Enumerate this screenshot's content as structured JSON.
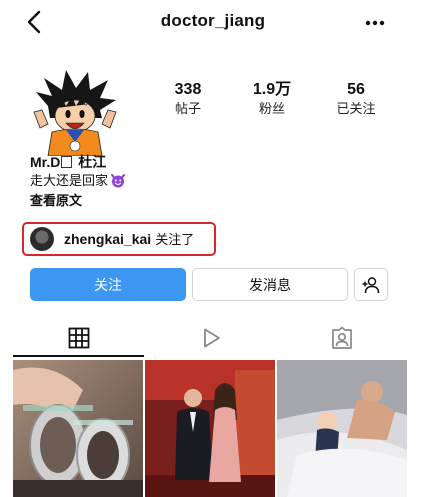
{
  "header": {
    "back_icon": "chevron-left-icon",
    "username": "doctor_jiang",
    "more_icon": "more-horizontal-icon"
  },
  "profile": {
    "avatar": "cartoon-boy-avatar",
    "stats": [
      {
        "value": "338",
        "label": "帖子"
      },
      {
        "value": "1.9万",
        "label": "粉丝"
      },
      {
        "value": "56",
        "label": "已关注"
      }
    ],
    "name_prefix": "Mr.D",
    "name_suffix": "杜江",
    "bio": "走大还是回家",
    "bio_emoji": "smiling-devil-icon",
    "see_more": "查看原文"
  },
  "followed_by": {
    "username": "zhengkai_kai",
    "suffix": "关注了",
    "highlight_color": "#d8262c"
  },
  "actions": {
    "follow_label": "关注",
    "message_label": "发消息",
    "add_user_icon": "person-add-icon",
    "follow_color": "#3d97f0"
  },
  "tabs": [
    {
      "icon": "grid-icon",
      "selected": true
    },
    {
      "icon": "reels-play-icon",
      "selected": false
    },
    {
      "icon": "tagged-person-icon",
      "selected": false
    }
  ],
  "posts": [
    {
      "subject": "jewelry-rings-photo"
    },
    {
      "subject": "couple-red-carpet-photo"
    },
    {
      "subject": "father-child-bed-photo"
    }
  ]
}
